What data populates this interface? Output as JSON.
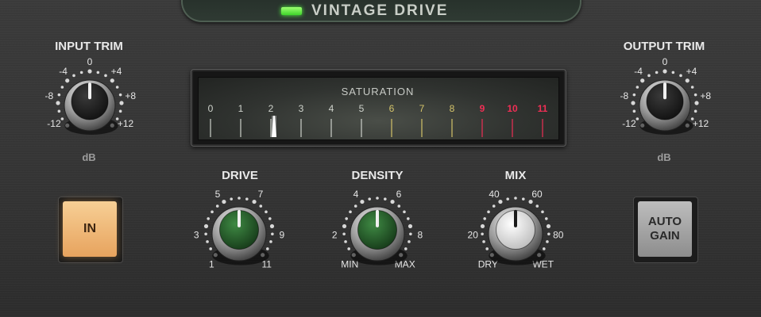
{
  "header": {
    "title": "VINTAGE DRIVE"
  },
  "input_trim": {
    "label": "INPUT TRIM",
    "unit": "dB",
    "value": 0,
    "scale": [
      "-12",
      "-8",
      "-4",
      "0",
      "+4",
      "+8",
      "+12"
    ]
  },
  "output_trim": {
    "label": "OUTPUT TRIM",
    "unit": "dB",
    "value": 0,
    "scale": [
      "-12",
      "-8",
      "-4",
      "0",
      "+4",
      "+8",
      "+12"
    ]
  },
  "meter": {
    "label": "SATURATION",
    "value": 2,
    "scale": [
      "0",
      "1",
      "2",
      "3",
      "4",
      "5",
      "6",
      "7",
      "8",
      "9",
      "10",
      "11"
    ],
    "colors": {
      "normal": "#cfd3cc",
      "warm": "#d4c36a",
      "hot": "#ef2f55"
    }
  },
  "drive": {
    "label": "DRIVE",
    "value": 6,
    "scale": [
      "1",
      "3",
      "5",
      "7",
      "9",
      "11"
    ],
    "cap_color": "#2f6b33"
  },
  "density": {
    "label": "DENSITY",
    "value": 5,
    "scale": [
      "MIN",
      "2",
      "4",
      "6",
      "8",
      "MAX"
    ],
    "cap_color": "#2f6b33"
  },
  "mix": {
    "label": "MIX",
    "value": 50,
    "scale": [
      "DRY",
      "20",
      "40",
      "60",
      "80",
      "WET"
    ],
    "cap_color": "#e8e8e8"
  },
  "buttons": {
    "in_label": "IN",
    "auto_gain_line1": "AUTO",
    "auto_gain_line2": "GAIN",
    "in_active": true,
    "auto_gain_active": false
  }
}
